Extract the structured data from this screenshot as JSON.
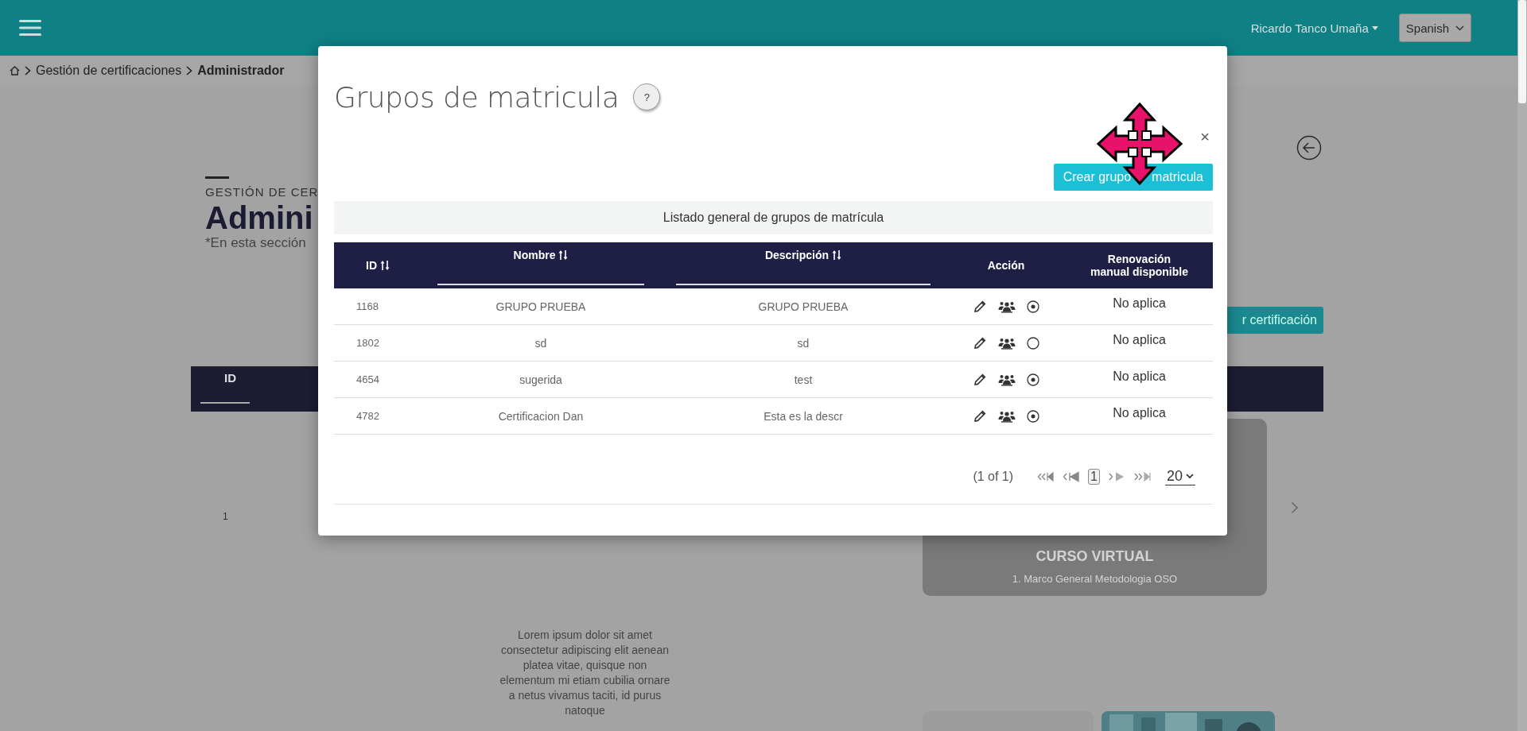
{
  "header": {
    "user_name": "Ricardo Tanco Umaña",
    "language": "Spanish"
  },
  "breadcrumb": [
    "Gestión de certificaciones",
    "Administrador"
  ],
  "page": {
    "section_label": "GESTIÓN DE CER",
    "title": "Admini",
    "subtitle": "*En esta sección",
    "table_header": "ID",
    "row_number": "1",
    "create_button": "r certificación",
    "card": {
      "title": "CURSO VIRTUAL",
      "subtitle": "1. Marco General Metodologia OSO"
    },
    "description": "Lorem ipsum dolor sit amet consectetur adipiscing elit aenean platea vitae, quisque non elementum mi etiam cubilia ornare a netus vivamus taciti, id purus natoque"
  },
  "modal": {
    "title": "Grupos de matricula",
    "help": "?",
    "close": "×",
    "create_button": [
      "Crear grupo",
      "matricula"
    ],
    "table": {
      "caption": "Listado general de grupos de matrícula",
      "columns": [
        {
          "label": "ID",
          "sortable": true,
          "filter": false
        },
        {
          "label": "Nombre",
          "sortable": true,
          "filter": true
        },
        {
          "label": "Descripción",
          "sortable": true,
          "filter": true
        },
        {
          "label": "Acción",
          "sortable": false,
          "filter": false
        },
        {
          "label": "Renovación manual disponible",
          "sortable": false,
          "filter": false
        }
      ],
      "rows": [
        {
          "id": "1168",
          "name": "GRUPO PRUEBA",
          "description": "GRUPO PRUEBA",
          "active": true,
          "renewal": "No aplica"
        },
        {
          "id": "1802",
          "name": "sd",
          "description": "sd",
          "active": false,
          "renewal": "No aplica"
        },
        {
          "id": "4654",
          "name": "sugerida",
          "description": "test",
          "active": true,
          "renewal": "No aplica"
        },
        {
          "id": "4782",
          "name": "Certificacion Dan",
          "description": "Esta es la descr",
          "active": true,
          "renewal": "No aplica"
        }
      ]
    },
    "pagination": {
      "summary": "(1 of 1)",
      "pages": [
        {
          "label": "1",
          "selected": true
        }
      ],
      "page_size": "20"
    }
  }
}
